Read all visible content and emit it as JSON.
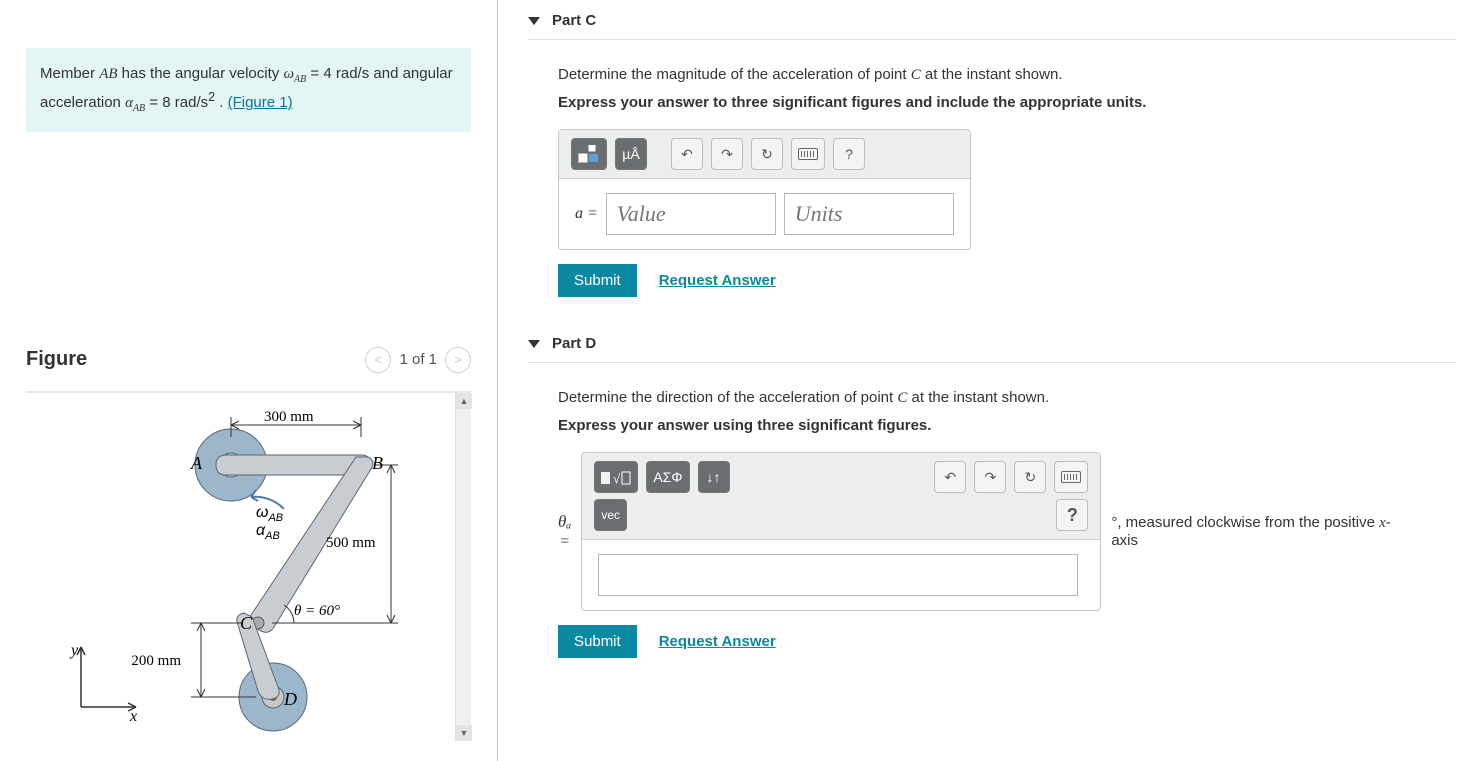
{
  "problem": {
    "text_prefix": "Member ",
    "var_member": "AB",
    "text_mid1": " has the angular velocity ",
    "var_omega": "ω",
    "var_omega_sub": "AB",
    "eq_omega": " = 4  rad/s",
    "text_mid2": " and angular acceleration ",
    "var_alpha": "α",
    "var_alpha_sub": "AB",
    "eq_alpha": " = 8  rad/s",
    "eq_alpha_exp": "2",
    "text_tail": " . ",
    "figure_link": "(Figure 1)"
  },
  "figure": {
    "heading": "Figure",
    "pager_text": "1 of 1",
    "dim_300": "300 mm",
    "dim_500": "500 mm",
    "dim_200": "200 mm",
    "theta": "θ = 60°",
    "label_A": "A",
    "label_B": "B",
    "label_C": "C",
    "label_D": "D",
    "label_omega": "ω",
    "label_omega_sub": "AB",
    "label_alpha": "α",
    "label_alpha_sub": "AB",
    "axis_x": "x",
    "axis_y": "y"
  },
  "partC": {
    "title": "Part C",
    "prompt1_pre": "Determine the magnitude of the acceleration of point ",
    "prompt1_var": "C",
    "prompt1_post": " at the instant shown.",
    "prompt2": "Express your answer to three significant figures and include the appropriate units.",
    "btn_templates": "▯▯",
    "btn_units": "µÅ",
    "btn_undo": "↶",
    "btn_redo": "↷",
    "btn_reset": "↻",
    "btn_help": "?",
    "label_a": "a =",
    "placeholder_value": "Value",
    "placeholder_units": "Units",
    "submit_label": "Submit",
    "request_answer": "Request Answer"
  },
  "partD": {
    "title": "Part D",
    "prompt1_pre": "Determine the direction of the acceleration of point ",
    "prompt1_var": "C",
    "prompt1_post": " at the instant shown.",
    "prompt2": "Express your answer using three significant figures.",
    "btn_sqrt": "▯√▯",
    "btn_greek": "ΑΣΦ",
    "btn_arrows": "↓↑",
    "btn_undo": "↶",
    "btn_redo": "↷",
    "btn_reset": "↻",
    "btn_vec": "vec",
    "btn_help": "?",
    "label_theta": "θₐ",
    "label_eq": "=",
    "suffix_pre": "°, measured clockwise from the positive ",
    "suffix_var": "x",
    "suffix_post": "-axis",
    "submit_label": "Submit",
    "request_answer": "Request Answer"
  }
}
